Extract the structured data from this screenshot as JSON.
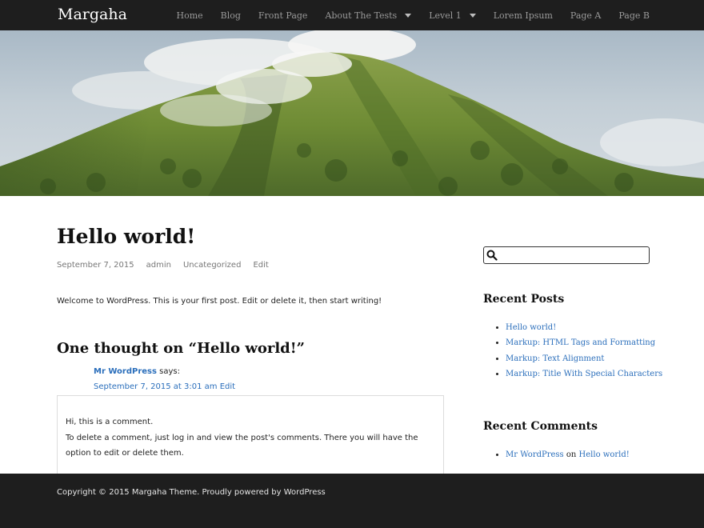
{
  "header": {
    "site_title": "Margaha",
    "nav": [
      {
        "label": "Home",
        "has_dropdown": false
      },
      {
        "label": "Blog",
        "has_dropdown": false
      },
      {
        "label": "Front Page",
        "has_dropdown": false
      },
      {
        "label": "About The Tests",
        "has_dropdown": true
      },
      {
        "label": "Level 1",
        "has_dropdown": true
      },
      {
        "label": "Lorem Ipsum",
        "has_dropdown": false
      },
      {
        "label": "Page A",
        "has_dropdown": false
      },
      {
        "label": "Page B",
        "has_dropdown": false
      }
    ]
  },
  "post": {
    "title": "Hello world!",
    "date": "September 7, 2015",
    "author": "admin",
    "category": "Uncategorized",
    "edit": "Edit",
    "body": "Welcome to WordPress. This is your first post. Edit or delete it, then start writing!"
  },
  "comments": {
    "title": "One thought on “Hello world!”",
    "items": [
      {
        "author": "Mr WordPress",
        "says": "says:",
        "date": "September 7, 2015 at 3:01 am",
        "edit": "Edit",
        "line1": "Hi, this is a comment.",
        "line2": "To delete a comment, just log in and view the post's comments. There you will have the option to edit or delete them."
      }
    ]
  },
  "sidebar": {
    "search_placeholder": "",
    "recent_posts_title": "Recent Posts",
    "recent_posts": [
      "Hello world!",
      "Markup: HTML Tags and Formatting",
      "Markup: Text Alignment",
      "Markup: Title With Special Characters"
    ],
    "recent_comments_title": "Recent Comments",
    "recent_comments": [
      {
        "author": "Mr WordPress",
        "on": "on",
        "post": "Hello world!"
      }
    ]
  },
  "footer": {
    "text": "Copyright © 2015 Margaha Theme. Proudly powered by WordPress"
  },
  "colors": {
    "topbar": "#1e1e1e",
    "link": "#2a6ebb",
    "footer": "#1e1e1e"
  }
}
